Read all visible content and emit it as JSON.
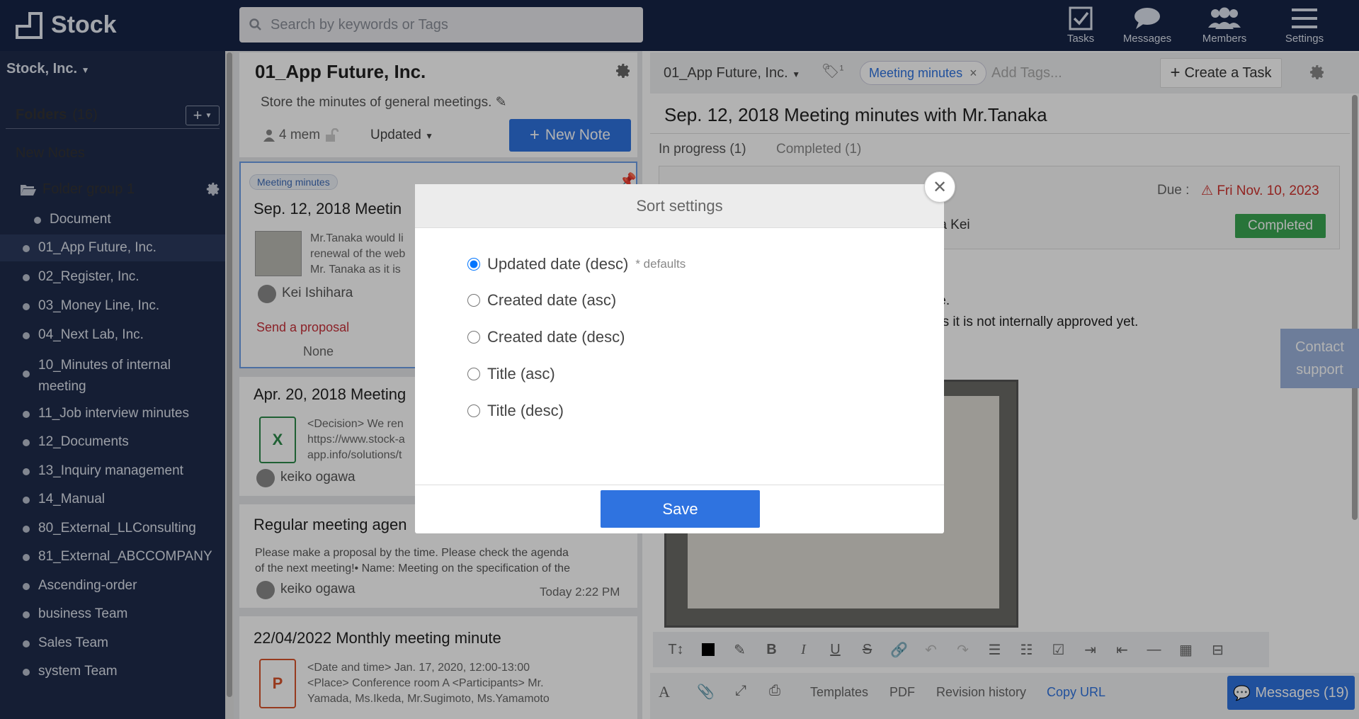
{
  "app": {
    "name": "Stock"
  },
  "search": {
    "placeholder": "Search by keywords or Tags"
  },
  "topnav": [
    {
      "label": "Tasks",
      "icon": "checkbox-icon"
    },
    {
      "label": "Messages",
      "icon": "chat-bubble-icon"
    },
    {
      "label": "Members",
      "icon": "members-icon"
    },
    {
      "label": "Settings",
      "icon": "hamburger-menu-icon"
    }
  ],
  "sidebar": {
    "company": "Stock, Inc.",
    "folders_label": "Folders",
    "folders_count": "(16)",
    "new_notes": "New Notes",
    "folder_group": "Folder group 1",
    "items": [
      {
        "label": "Document"
      },
      {
        "label": "01_App Future, Inc.",
        "selected": true
      },
      {
        "label": "02_Register, Inc."
      },
      {
        "label": "03_Money Line, Inc."
      },
      {
        "label": "04_Next Lab, Inc."
      },
      {
        "label": "10_Minutes of internal meeting"
      },
      {
        "label": "11_Job interview minutes"
      },
      {
        "label": "12_Documents"
      },
      {
        "label": "13_Inquiry management"
      },
      {
        "label": "14_Manual"
      },
      {
        "label": "80_External_LLConsulting"
      },
      {
        "label": "81_External_ABCCOMPANY"
      },
      {
        "label": "Ascending-order"
      },
      {
        "label": "business Team"
      },
      {
        "label": "Sales Team"
      },
      {
        "label": "system Team"
      }
    ]
  },
  "folder": {
    "title": "01_App Future, Inc.",
    "description": "Store the minutes of general meetings.",
    "members": "4 mem",
    "sort_label": "Updated",
    "new_note": "New Note"
  },
  "notes": [
    {
      "tag": "Meeting minutes",
      "title": "Sep. 12, 2018 Meetin",
      "lines": [
        "Mr.Tanaka would li",
        "renewal of the web",
        "Mr. Tanaka as it is"
      ],
      "author": "Kei Ishihara",
      "task": "Send a proposal",
      "task_assignee": "None"
    },
    {
      "title": "Apr. 20, 2018 Meeting",
      "file_letter": "X",
      "lines": [
        "<Decision> We ren",
        "https://www.stock-a",
        "app.info/solutions/t"
      ],
      "author": "keiko ogawa"
    },
    {
      "title": "Regular meeting agen",
      "lines": [
        "Please make a proposal by the time.   Please check the agenda",
        "of the next meeting!• Name: Meeting on the specification of the"
      ],
      "author": "keiko ogawa",
      "time": "Today 2:22 PM"
    },
    {
      "title": "22/04/2022 Monthly meeting minute",
      "file_letter": "P",
      "lines": [
        "<Date and time>    Jan. 17, 2020, 12:00-13:00",
        "<Place> Conference room A <Participants> Mr.",
        "Yamada, Ms.Ikeda, Mr.Sugimoto, Ms.Yamamoto"
      ]
    }
  ],
  "detail": {
    "breadcrumb": "01_App Future, Inc.",
    "tag_count": "1",
    "tag": "Meeting minutes",
    "add_tags_placeholder": "Add Tags...",
    "create_task": "Create a Task",
    "title": "Sep. 12, 2018 Meeting minutes with Mr.Tanaka",
    "tab_in_progress": "In progress  (1)",
    "tab_completed": "Completed  (1)",
    "due_label": "Due :",
    "due_date": "Fri Nov. 10, 2023",
    "assignee_partial": "ra Kei",
    "completed_badge": "Completed",
    "body_line1": "te.",
    "body_line2": "as it is not internally approved yet.",
    "contact_support": "Contact support",
    "bottom": {
      "templates": "Templates",
      "pdf": "PDF",
      "revision": "Revision history",
      "copy_url": "Copy URL"
    },
    "messages": "Messages (19)"
  },
  "modal": {
    "title": "Sort settings",
    "options": [
      {
        "label": "Updated date (desc)",
        "checked": true,
        "note": "* defaults"
      },
      {
        "label": "Created date (asc)"
      },
      {
        "label": "Created date (desc)"
      },
      {
        "label": "Title (asc)"
      },
      {
        "label": "Title (desc)"
      }
    ],
    "save": "Save"
  },
  "colors": {
    "topbar": "#162447",
    "sidebar": "#1f2b4b",
    "accent": "#2f73e0",
    "success": "#3aa652",
    "danger": "#d0312d"
  }
}
